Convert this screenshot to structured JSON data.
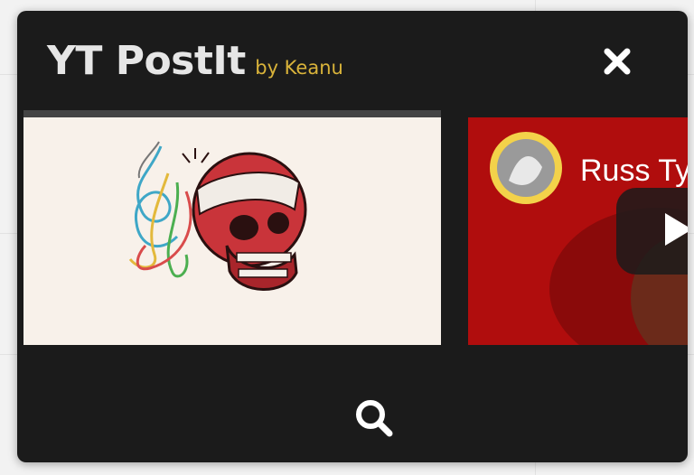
{
  "app": {
    "title": "YT PostIt",
    "byline": "by Keanu"
  },
  "videos": [
    {
      "thumbnail": "skull-illustration-thumbnail"
    },
    {
      "channel_name": "Russ Ty",
      "thumbnail": "red-video-thumbnail"
    }
  ],
  "icons": {
    "close": "close-icon",
    "search": "search-icon",
    "play": "play-icon"
  },
  "colors": {
    "background": "#1b1b1b",
    "title": "#e6e6e6",
    "byline": "#d9b33a",
    "video_red": "#b00d0d"
  }
}
